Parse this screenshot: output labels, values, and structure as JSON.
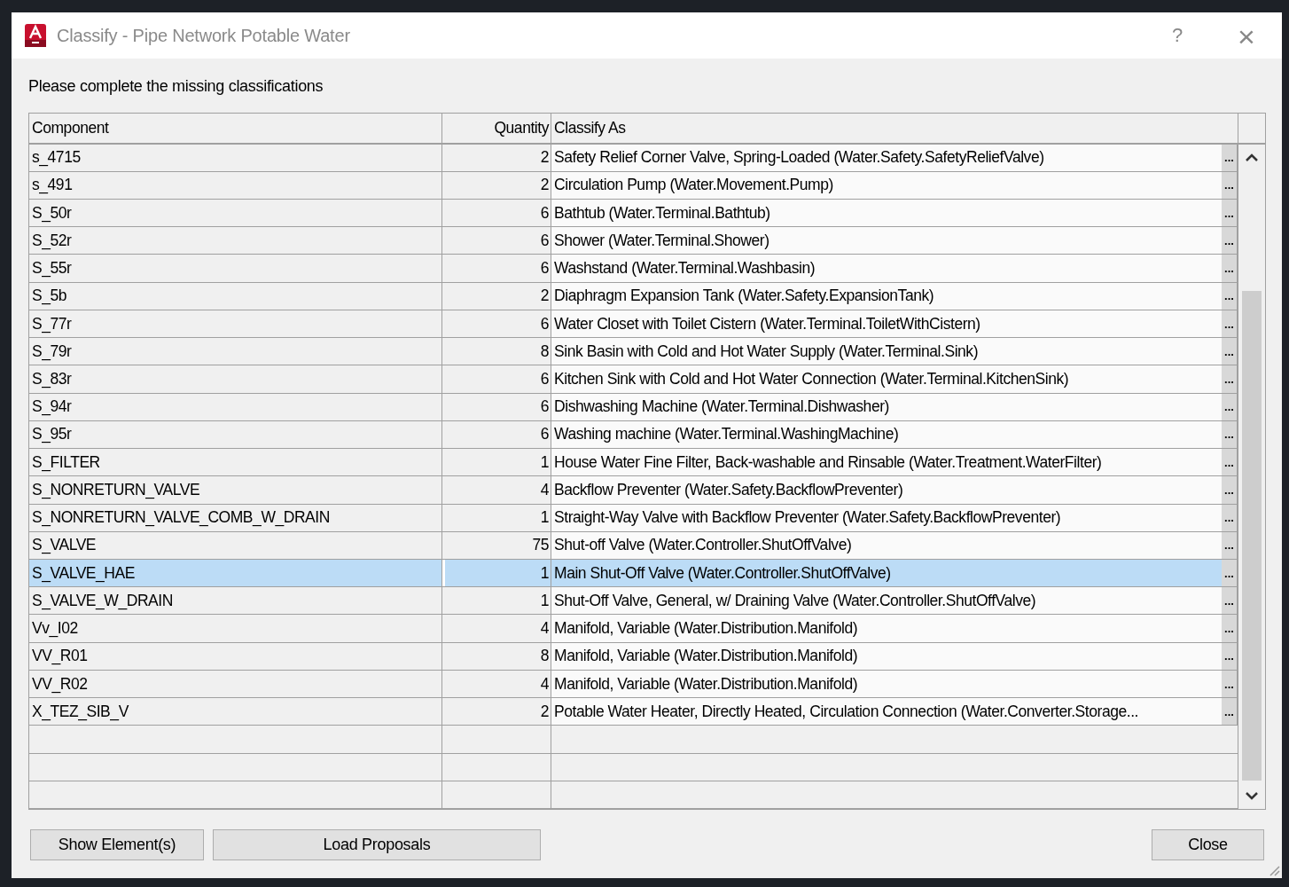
{
  "window": {
    "title": "Classify - Pipe Network Potable Water",
    "help": "?",
    "close": "×"
  },
  "instruction": "Please complete the missing classifications",
  "table": {
    "columns": [
      "Component",
      "Quantity",
      "Classify As"
    ],
    "rows": [
      {
        "component": "s_4715",
        "quantity": "2",
        "classify_as": "Safety Relief Corner Valve, Spring-Loaded (Water.Safety.SafetyReliefValve)",
        "browse": "...",
        "selected": false
      },
      {
        "component": "s_491",
        "quantity": "2",
        "classify_as": "Circulation Pump (Water.Movement.Pump)",
        "browse": "...",
        "selected": false
      },
      {
        "component": "S_50r",
        "quantity": "6",
        "classify_as": "Bathtub (Water.Terminal.Bathtub)",
        "browse": "...",
        "selected": false
      },
      {
        "component": "S_52r",
        "quantity": "6",
        "classify_as": "Shower (Water.Terminal.Shower)",
        "browse": "...",
        "selected": false
      },
      {
        "component": "S_55r",
        "quantity": "6",
        "classify_as": "Washstand (Water.Terminal.Washbasin)",
        "browse": "...",
        "selected": false
      },
      {
        "component": "S_5b",
        "quantity": "2",
        "classify_as": "Diaphragm Expansion Tank (Water.Safety.ExpansionTank)",
        "browse": "...",
        "selected": false
      },
      {
        "component": "S_77r",
        "quantity": "6",
        "classify_as": "Water Closet with Toilet Cistern (Water.Terminal.ToiletWithCistern)",
        "browse": "...",
        "selected": false
      },
      {
        "component": "S_79r",
        "quantity": "8",
        "classify_as": "Sink Basin with Cold and Hot Water Supply (Water.Terminal.Sink)",
        "browse": "...",
        "selected": false
      },
      {
        "component": "S_83r",
        "quantity": "6",
        "classify_as": "Kitchen Sink with Cold and Hot Water Connection (Water.Terminal.KitchenSink)",
        "browse": "...",
        "selected": false
      },
      {
        "component": "S_94r",
        "quantity": "6",
        "classify_as": "Dishwashing Machine (Water.Terminal.Dishwasher)",
        "browse": "...",
        "selected": false
      },
      {
        "component": "S_95r",
        "quantity": "6",
        "classify_as": "Washing machine (Water.Terminal.WashingMachine)",
        "browse": "...",
        "selected": false
      },
      {
        "component": "S_FILTER",
        "quantity": "1",
        "classify_as": "House Water Fine Filter, Back-washable and Rinsable (Water.Treatment.WaterFilter)",
        "browse": "...",
        "selected": false
      },
      {
        "component": "S_NONRETURN_VALVE",
        "quantity": "4",
        "classify_as": "Backflow Preventer (Water.Safety.BackflowPreventer)",
        "browse": "...",
        "selected": false
      },
      {
        "component": "S_NONRETURN_VALVE_COMB_W_DRAIN",
        "quantity": "1",
        "classify_as": "Straight-Way Valve with Backflow Preventer (Water.Safety.BackflowPreventer)",
        "browse": "...",
        "selected": false
      },
      {
        "component": "S_VALVE",
        "quantity": "75",
        "classify_as": "Shut-off Valve (Water.Controller.ShutOffValve)",
        "browse": "...",
        "selected": false
      },
      {
        "component": "S_VALVE_HAE",
        "quantity": "1",
        "classify_as": "Main Shut-Off Valve (Water.Controller.ShutOffValve)",
        "browse": "...",
        "selected": true
      },
      {
        "component": "S_VALVE_W_DRAIN",
        "quantity": "1",
        "classify_as": "Shut-Off Valve, General, w/ Draining Valve (Water.Controller.ShutOffValve)",
        "browse": "...",
        "selected": false
      },
      {
        "component": "Vv_I02",
        "quantity": "4",
        "classify_as": "Manifold, Variable (Water.Distribution.Manifold)",
        "browse": "...",
        "selected": false
      },
      {
        "component": "VV_R01",
        "quantity": "8",
        "classify_as": "Manifold, Variable (Water.Distribution.Manifold)",
        "browse": "...",
        "selected": false
      },
      {
        "component": "VV_R02",
        "quantity": "4",
        "classify_as": "Manifold, Variable (Water.Distribution.Manifold)",
        "browse": "...",
        "selected": false
      },
      {
        "component": "X_TEZ_SIB_V",
        "quantity": "2",
        "classify_as": "Potable Water Heater, Directly Heated, Circulation Connection (Water.Converter.Storage...",
        "browse": "...",
        "selected": false
      }
    ]
  },
  "buttons": {
    "left": [
      "Show Element(s)",
      "Load Proposals"
    ],
    "right": [
      "Close"
    ]
  }
}
